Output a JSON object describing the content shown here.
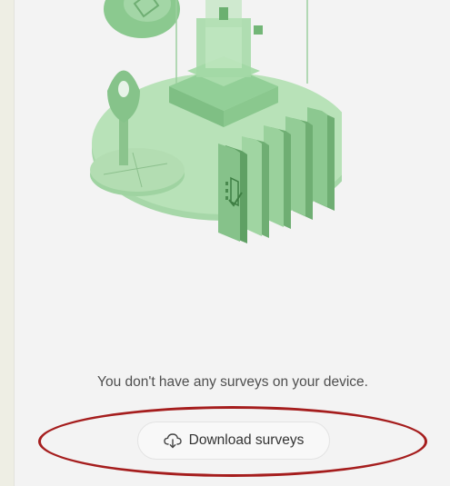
{
  "empty_state": {
    "message": "You don't have any surveys on your device.",
    "download_button_label": "Download surveys",
    "download_button_icon": "cloud-download-icon"
  },
  "colors": {
    "illustration_green": "#8fce9a",
    "highlight_ring": "#a51d1d"
  }
}
